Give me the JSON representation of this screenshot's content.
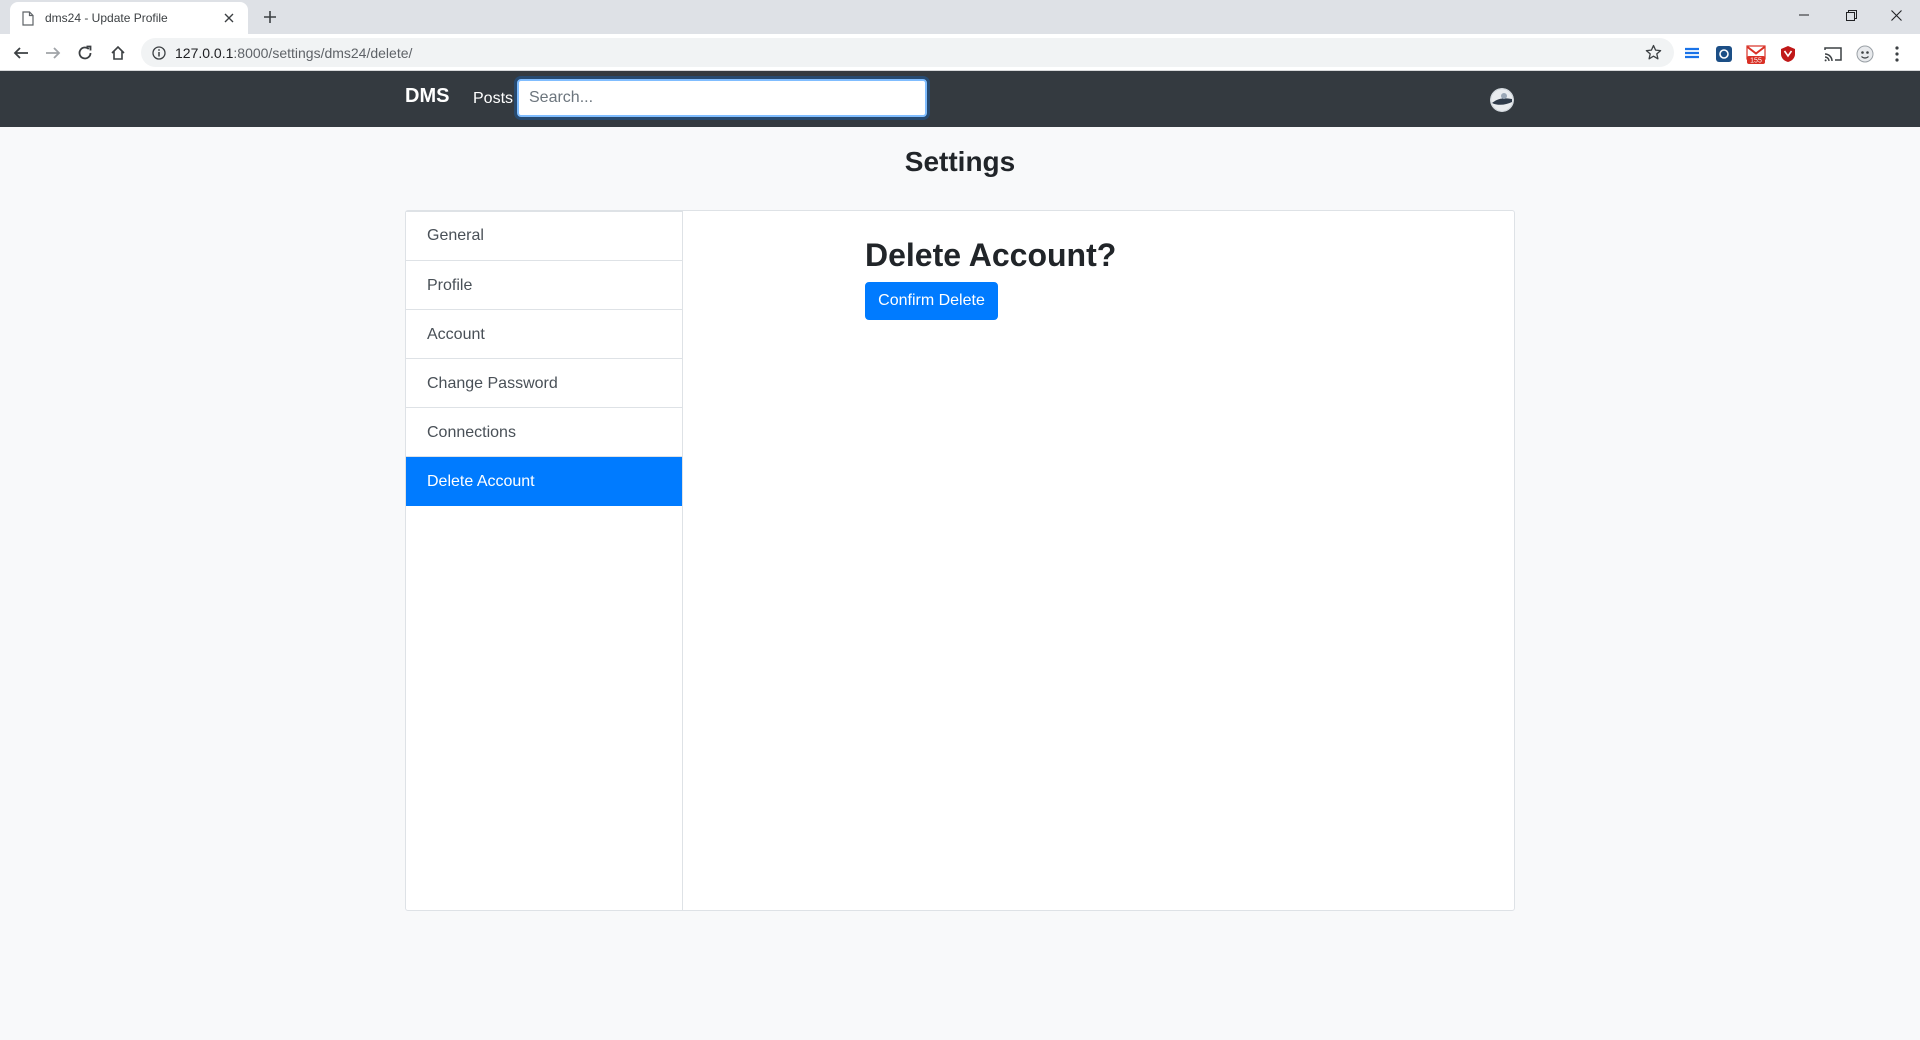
{
  "browser": {
    "tab_title": "dms24 - Update Profile",
    "url_host": "127.0.0.1",
    "url_path": ":8000/settings/dms24/delete/",
    "extensions": [
      {
        "name": "layers-extension-icon",
        "color": "#1a73e8"
      },
      {
        "name": "shield-extension-icon",
        "color": "#1c4f86"
      },
      {
        "name": "gmail-extension-icon",
        "color": "#d93025",
        "badge": "155"
      },
      {
        "name": "mcafee-extension-icon",
        "color": "#c01818"
      }
    ]
  },
  "navbar": {
    "brand": "DMS",
    "posts_label": "Posts",
    "search_placeholder": "Search..."
  },
  "page": {
    "title": "Settings"
  },
  "sidebar": {
    "items": [
      {
        "label": "General",
        "active": false
      },
      {
        "label": "Profile",
        "active": false
      },
      {
        "label": "Account",
        "active": false
      },
      {
        "label": "Change Password",
        "active": false
      },
      {
        "label": "Connections",
        "active": false
      },
      {
        "label": "Delete Account",
        "active": true
      }
    ]
  },
  "main": {
    "heading": "Delete Account?",
    "confirm_label": "Confirm Delete"
  },
  "colors": {
    "primary": "#007bff",
    "navbar_bg": "#343a40",
    "page_bg": "#f8f9fa"
  }
}
